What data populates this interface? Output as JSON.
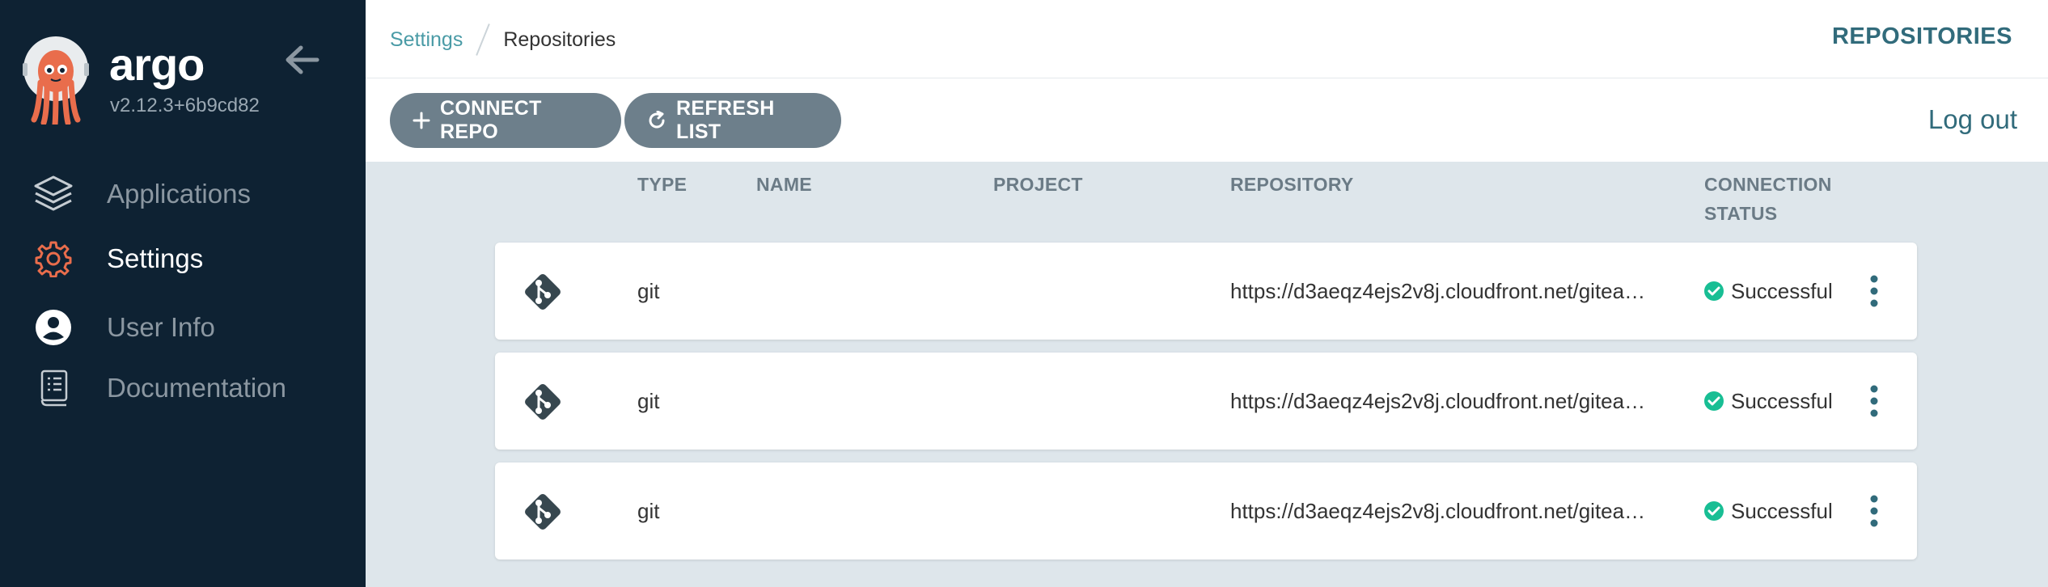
{
  "brand": {
    "name": "argo",
    "version": "v2.12.3+6b9cd82"
  },
  "sidebar": {
    "items": [
      {
        "label": "Applications",
        "icon": "layers-icon",
        "active": false
      },
      {
        "label": "Settings",
        "icon": "gear-icon",
        "active": true
      },
      {
        "label": "User Info",
        "icon": "user-circle-icon",
        "active": false
      },
      {
        "label": "Documentation",
        "icon": "book-icon",
        "active": false
      }
    ]
  },
  "breadcrumb": {
    "parent": "Settings",
    "current": "Repositories"
  },
  "page_title": "REPOSITORIES",
  "toolbar": {
    "connect_label": "CONNECT REPO",
    "refresh_label": "REFRESH LIST",
    "logout_label": "Log out"
  },
  "table": {
    "headers": {
      "type": "TYPE",
      "name": "NAME",
      "project": "PROJECT",
      "repository": "REPOSITORY",
      "status_line1": "CONNECTION",
      "status_line2": "STATUS"
    },
    "rows": [
      {
        "type": "git",
        "name": "",
        "project": "",
        "repository": "https://d3aeqz4ejs2v8j.cloudfront.net/gitea…",
        "status": "Successful"
      },
      {
        "type": "git",
        "name": "",
        "project": "",
        "repository": "https://d3aeqz4ejs2v8j.cloudfront.net/gitea…",
        "status": "Successful"
      },
      {
        "type": "git",
        "name": "",
        "project": "",
        "repository": "https://d3aeqz4ejs2v8j.cloudfront.net/gitea…",
        "status": "Successful"
      }
    ]
  },
  "colors": {
    "sidebar_bg": "#0e2233",
    "accent": "#316b7b",
    "button_bg": "#6d7f8b",
    "success": "#18be94",
    "settings_icon": "#e96d4c"
  }
}
